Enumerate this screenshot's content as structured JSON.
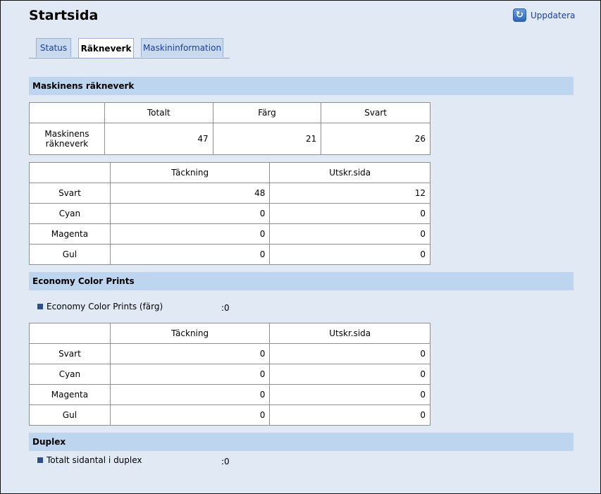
{
  "page_title": "Startsida",
  "refresh_label": "Uppdatera",
  "tabs": [
    {
      "label": "Status"
    },
    {
      "label": "Räkneverk"
    },
    {
      "label": "Maskininformation"
    }
  ],
  "section_machine": {
    "title": "Maskinens räkneverk",
    "counter_table": {
      "headers": [
        "",
        "Totalt",
        "Färg",
        "Svart"
      ],
      "row_label": "Maskinens räkneverk",
      "values": [
        "47",
        "21",
        "26"
      ]
    },
    "coverage_table": {
      "headers": [
        "",
        "Täckning",
        "Utskr.sida"
      ],
      "rows": [
        {
          "label": "Svart",
          "coverage": "48",
          "pages": "12"
        },
        {
          "label": "Cyan",
          "coverage": "0",
          "pages": "0"
        },
        {
          "label": "Magenta",
          "coverage": "0",
          "pages": "0"
        },
        {
          "label": "Gul",
          "coverage": "0",
          "pages": "0"
        }
      ]
    }
  },
  "section_economy": {
    "title": "Economy Color Prints",
    "item_label": "Economy Color Prints (färg)",
    "item_value": ":0",
    "coverage_table": {
      "headers": [
        "",
        "Täckning",
        "Utskr.sida"
      ],
      "rows": [
        {
          "label": "Svart",
          "coverage": "0",
          "pages": "0"
        },
        {
          "label": "Cyan",
          "coverage": "0",
          "pages": "0"
        },
        {
          "label": "Magenta",
          "coverage": "0",
          "pages": "0"
        },
        {
          "label": "Gul",
          "coverage": "0",
          "pages": "0"
        }
      ]
    }
  },
  "section_duplex": {
    "title": "Duplex",
    "item_label": "Totalt sidantal i duplex",
    "item_value": ":0"
  }
}
